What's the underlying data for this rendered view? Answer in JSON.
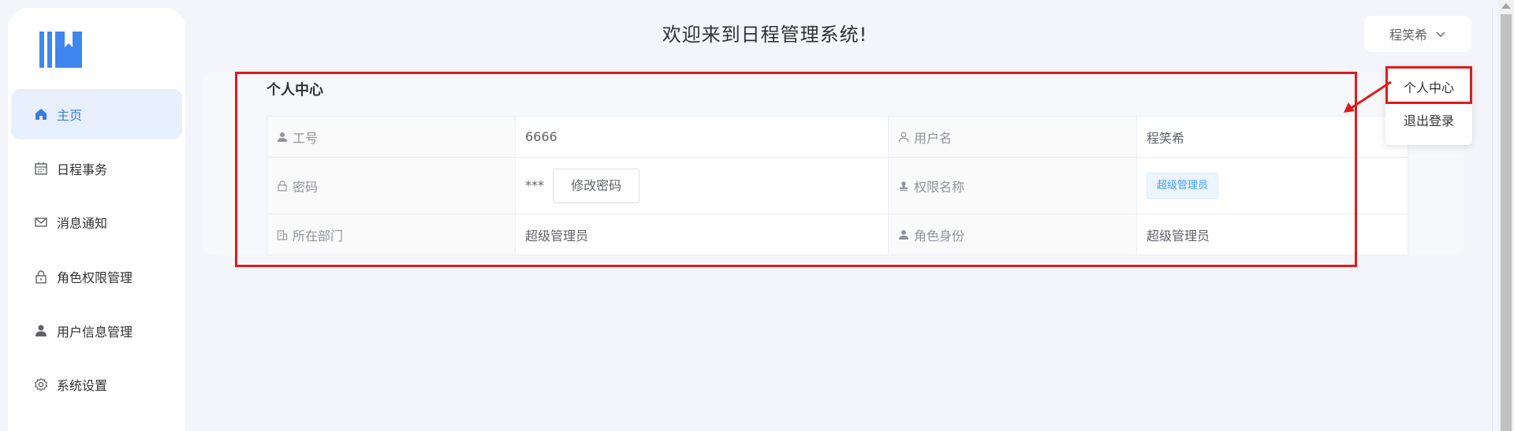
{
  "header": {
    "title": "欢迎来到日程管理系统!",
    "user_name": "程笑希"
  },
  "dropdown": {
    "items": [
      "个人中心",
      "退出登录"
    ]
  },
  "sidebar": {
    "items": [
      {
        "label": "主页",
        "icon": "home-icon",
        "active": true
      },
      {
        "label": "日程事务",
        "icon": "calendar-icon",
        "active": false
      },
      {
        "label": "消息通知",
        "icon": "mail-icon",
        "active": false
      },
      {
        "label": "角色权限管理",
        "icon": "lock-icon",
        "active": false
      },
      {
        "label": "用户信息管理",
        "icon": "user-icon",
        "active": false
      },
      {
        "label": "系统设置",
        "icon": "gear-icon",
        "active": false
      }
    ]
  },
  "profile": {
    "title": "个人中心",
    "job_no_label": "工号",
    "job_no": "6666",
    "username_label": "用户名",
    "username": "程笑希",
    "password_label": "密码",
    "password_mask": "***",
    "change_password": "修改密码",
    "permission_label": "权限名称",
    "permission": "超级管理员",
    "department_label": "所在部门",
    "department": "超级管理员",
    "role_label": "角色身份",
    "role": "超级管理员"
  },
  "colors": {
    "accent": "#3a7ce0",
    "highlight": "#e01b1b",
    "tag": "#409eff"
  }
}
